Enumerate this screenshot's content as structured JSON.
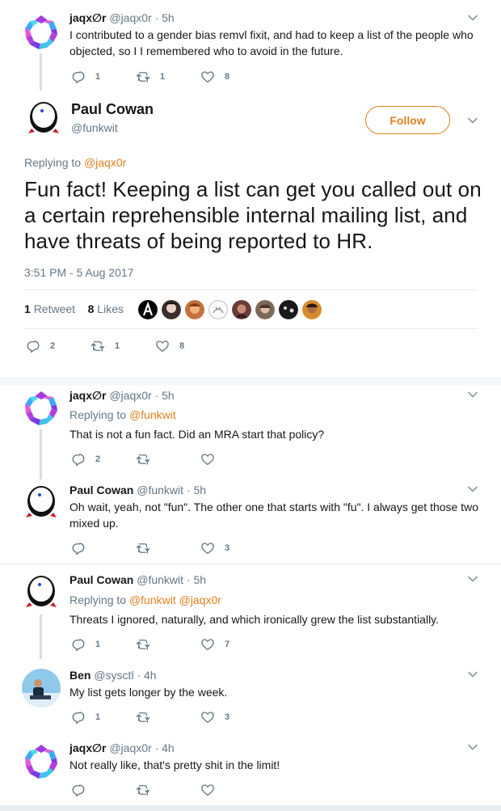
{
  "colors": {
    "accent": "#e0801d",
    "text": "#14171a",
    "muted": "#657786",
    "line": "#e6ecf0"
  },
  "tweet1": {
    "name": "jaqx∅r",
    "handle": "@jaqx0r",
    "time": "· 5h",
    "text": "I contributed to a gender bias remvl fixit, and had to keep a list of the people who objected, so I I remembered who to avoid in the future.",
    "replies": "1",
    "retweets": "1",
    "likes": "8"
  },
  "main": {
    "name": "Paul Cowan",
    "handle": "@funkwit",
    "follow": "Follow",
    "replying_prefix": "Replying to",
    "replying_to": "@jaqx0r",
    "text": "Fun fact! Keeping a list can get you called out on a certain reprehensible internal mailing list, and have threats of being reported to HR.",
    "timestamp": "3:51 PM - 5 Aug 2017",
    "retweet_count": "1",
    "retweet_label": "Retweet",
    "like_count": "8",
    "like_label": "Likes",
    "replies": "2",
    "retweets": "1",
    "likes": "8"
  },
  "reply1": {
    "name": "jaqx∅r",
    "handle": "@jaqx0r",
    "time": "· 5h",
    "replying_prefix": "Replying to",
    "replying_to": "@funkwit",
    "text": "That is not a fun fact. Did an MRA start that policy?",
    "replies": "2",
    "retweets": "",
    "likes": ""
  },
  "reply2": {
    "name": "Paul Cowan",
    "handle": "@funkwit",
    "time": "· 5h",
    "text": "Oh wait, yeah, not \"fun\". The other one that starts with \"fu\". I always get those two mixed up.",
    "replies": "",
    "retweets": "",
    "likes": "3"
  },
  "reply3": {
    "name": "Paul Cowan",
    "handle": "@funkwit",
    "time": "· 5h",
    "replying_prefix": "Replying to",
    "replying_to": "@funkwit @jaqx0r",
    "text": "Threats I ignored, naturally, and which ironically grew the list substantially.",
    "replies": "1",
    "retweets": "",
    "likes": "7"
  },
  "reply4": {
    "name": "Ben",
    "handle": "@sysctl",
    "time": "· 4h",
    "text": "My list gets longer by the week.",
    "replies": "1",
    "retweets": "",
    "likes": "3"
  },
  "reply5": {
    "name": "jaqx∅r",
    "handle": "@jaqx0r",
    "time": "· 4h",
    "text": "Not really like, that's pretty shit in the limit!",
    "replies": "",
    "retweets": "",
    "likes": ""
  }
}
